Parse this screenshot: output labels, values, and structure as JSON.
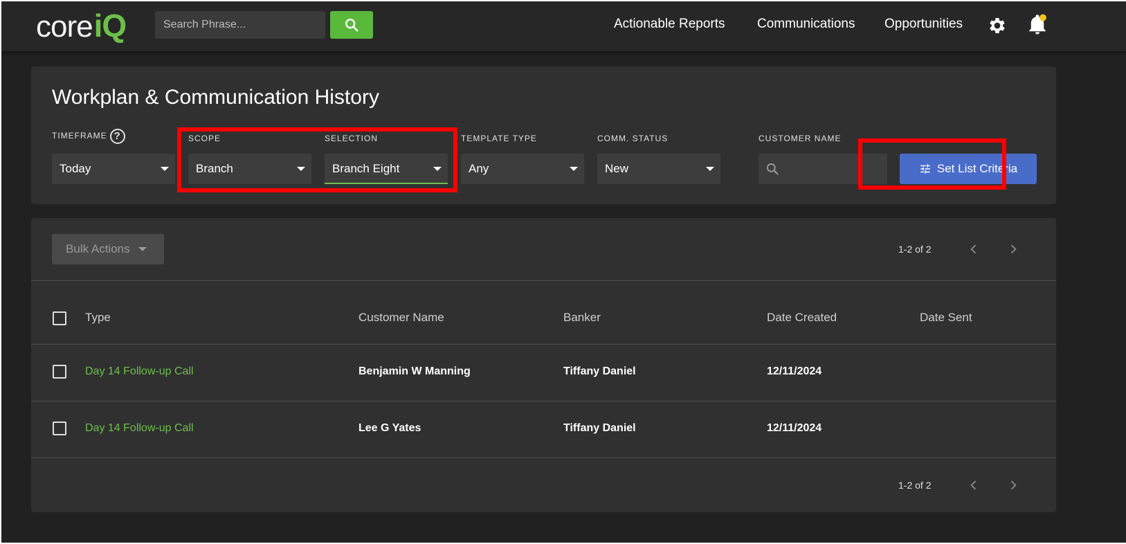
{
  "header": {
    "logo_core": "core",
    "logo_iq": "iQ",
    "search_placeholder": "Search Phrase...",
    "nav": [
      "Actionable Reports",
      "Communications",
      "Opportunities"
    ],
    "notification_dot_color": "#f5c518"
  },
  "filters": {
    "title": "Workplan & Communication History",
    "timeframe": {
      "label": "TIMEFRAME",
      "value": "Today"
    },
    "scope": {
      "label": "SCOPE",
      "value": "Branch"
    },
    "selection": {
      "label": "SELECTION",
      "value": "Branch Eight"
    },
    "template_type": {
      "label": "TEMPLATE TYPE",
      "value": "Any"
    },
    "comm_status": {
      "label": "COMM. STATUS",
      "value": "New"
    },
    "customer_name": {
      "label": "CUSTOMER NAME",
      "value": ""
    },
    "set_list_criteria": "Set List Criteria"
  },
  "table": {
    "bulk_actions": "Bulk Actions",
    "pagination": "1-2 of 2",
    "columns": [
      "Type",
      "Customer Name",
      "Banker",
      "Date Created",
      "Date Sent"
    ],
    "rows": [
      {
        "type": "Day 14 Follow-up Call",
        "customer": "Benjamin W Manning",
        "banker": "Tiffany Daniel",
        "created": "12/11/2024",
        "sent": ""
      },
      {
        "type": "Day 14 Follow-up Call",
        "customer": "Lee G Yates",
        "banker": "Tiffany Daniel",
        "created": "12/11/2024",
        "sent": ""
      }
    ]
  },
  "colors": {
    "accent_green": "#6cc04a",
    "button_blue": "#4a6cc9",
    "highlight_red": "#ff0000",
    "background": "#212121",
    "panel": "#303030"
  }
}
